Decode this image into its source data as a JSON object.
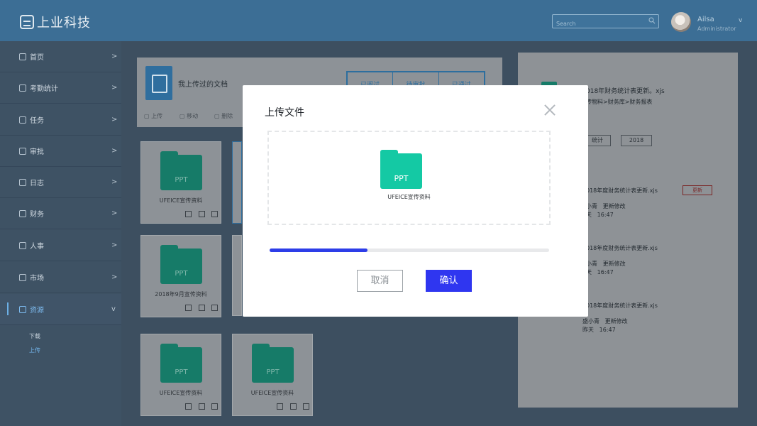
{
  "header": {
    "logo_text": "上业科技",
    "search_placeholder": "Search",
    "user_name": "Ailsa",
    "user_role": "Administrator",
    "user_caret": "v"
  },
  "sidebar": {
    "items": [
      {
        "label": "首页",
        "arrow": ">",
        "icon": "home-icon"
      },
      {
        "label": "考勤统计",
        "arrow": ">",
        "icon": "attendance-icon"
      },
      {
        "label": "任务",
        "arrow": ">",
        "icon": "task-icon"
      },
      {
        "label": "审批",
        "arrow": ">",
        "icon": "approval-icon"
      },
      {
        "label": "日志",
        "arrow": ">",
        "icon": "log-icon"
      },
      {
        "label": "财务",
        "arrow": ">",
        "icon": "finance-icon"
      },
      {
        "label": "人事",
        "arrow": ">",
        "icon": "hr-icon"
      },
      {
        "label": "市场",
        "arrow": ">",
        "icon": "market-icon"
      },
      {
        "label": "资源",
        "arrow": "v",
        "icon": "filter-icon"
      }
    ],
    "sub_items": [
      {
        "label": "下载"
      },
      {
        "label": "上传"
      }
    ]
  },
  "docs": {
    "title": "我上传过的文档",
    "tabs": [
      "已阅过",
      "待审批",
      "已通过"
    ],
    "actions": [
      "上传",
      "移动",
      "删除"
    ]
  },
  "cards": [
    {
      "type": "PPT",
      "name": "UFEICE宣传资料"
    },
    {
      "type": "PPT",
      "name": "2018年9月宣传资料"
    },
    {
      "type": "PPT",
      "name": "UFEICE宣传资料"
    },
    {
      "type": "PPT",
      "name": "UFEICE宣传资料"
    }
  ],
  "side_panel": {
    "title": "018年财务统计表更新。xjs",
    "path": "传物料>财务库>财务报表",
    "tags": [
      "统计",
      "2018"
    ],
    "entries": [
      {
        "file": "018年度财务统计表更新.xjs",
        "user": "小青",
        "action": "更新修改",
        "day": "天",
        "time": "16:47",
        "badge": "更新"
      },
      {
        "file": "018年度财务统计表更新.xjs",
        "user": "小青",
        "action": "更新修改",
        "day": "天",
        "time": "16:47"
      },
      {
        "file": "018年度财务统计表更新.xjs",
        "user": "盛小青",
        "action": "更新修改",
        "day": "昨天",
        "time": "16:47"
      }
    ]
  },
  "modal": {
    "title": "上传文件",
    "file_type": "PPT",
    "file_name": "UFEICE宣传资料",
    "progress_fraction": 0.35,
    "cancel_label": "取消",
    "confirm_label": "确认"
  },
  "colors": {
    "header": "#3c6e95",
    "sidebar": "#3e5264",
    "accent": "#2f36f0",
    "folder": "#14c9a4"
  }
}
